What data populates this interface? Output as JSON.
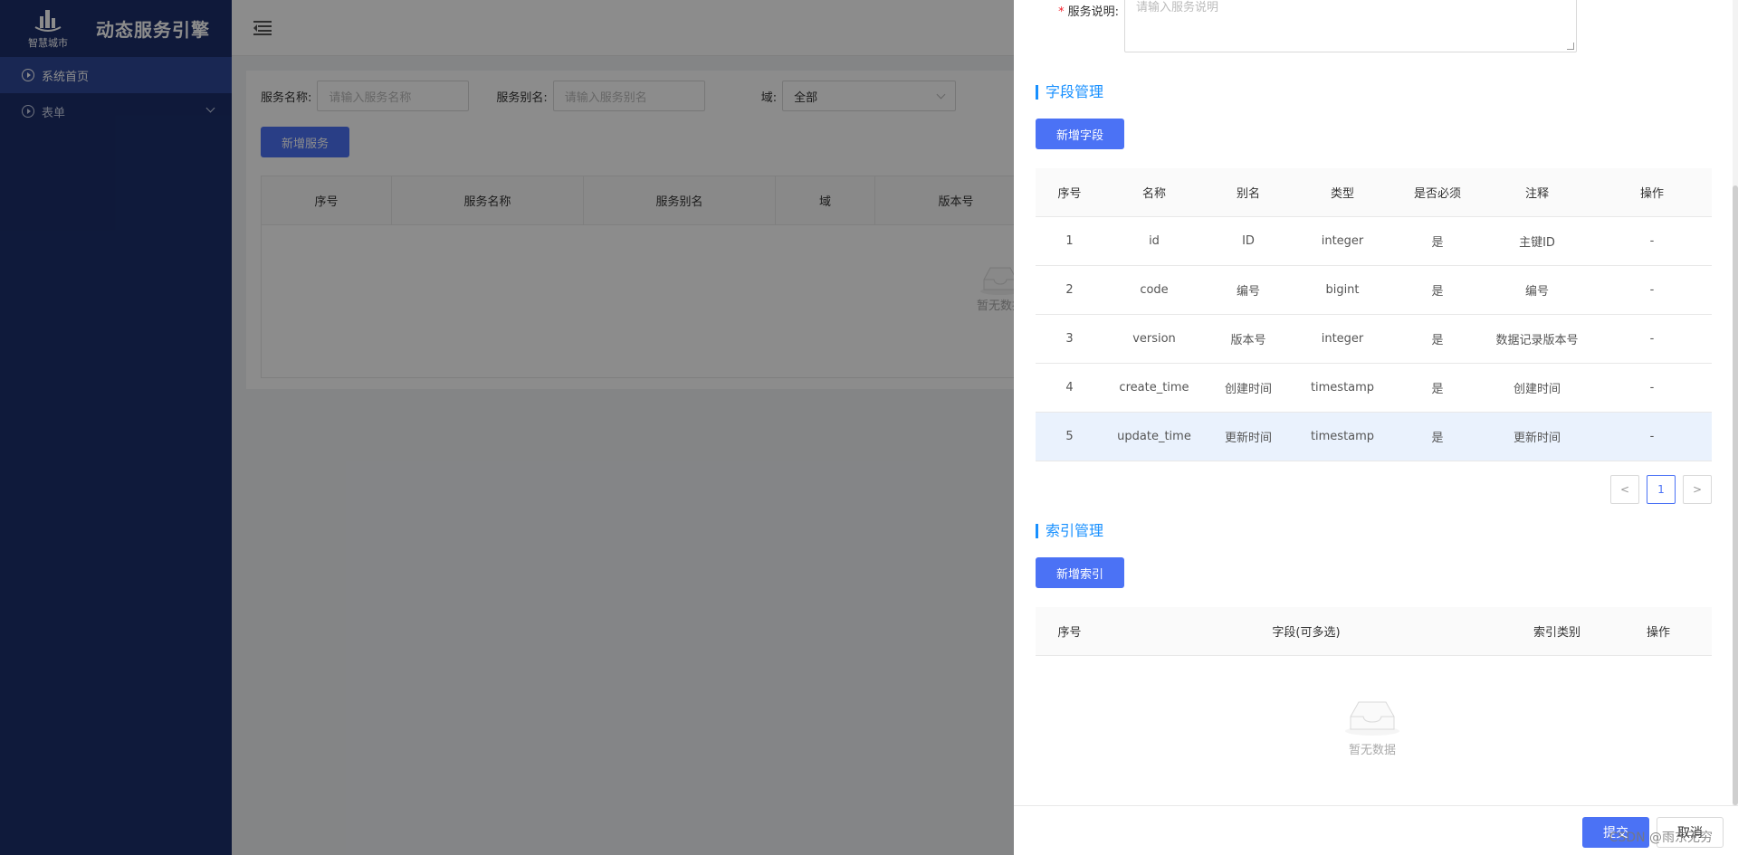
{
  "sidebar": {
    "logo_text": "智慧城市",
    "app_title": "动态服务引擎",
    "items": [
      {
        "label": "系统首页",
        "icon": "play-circle-icon",
        "active": true
      },
      {
        "label": "表单",
        "icon": "play-circle-icon",
        "expandable": true
      }
    ]
  },
  "filters": {
    "service_name_label": "服务名称:",
    "service_name_placeholder": "请输入服务名称",
    "service_alias_label": "服务别名:",
    "service_alias_placeholder": "请输入服务别名",
    "domain_label": "域:",
    "domain_value": "全部"
  },
  "toolbar": {
    "add_service_label": "新增服务"
  },
  "service_table": {
    "columns": [
      "序号",
      "服务名称",
      "服务别名",
      "域",
      "版本号"
    ],
    "empty_text": "暂无数据"
  },
  "drawer": {
    "description_label": "服务说明:",
    "description_placeholder": "请输入服务说明",
    "field_section": {
      "title": "字段管理",
      "add_label": "新增字段",
      "columns": [
        "序号",
        "名称",
        "别名",
        "类型",
        "是否必须",
        "注释",
        "操作"
      ],
      "rows": [
        [
          "1",
          "id",
          "ID",
          "integer",
          "是",
          "主键ID",
          "-"
        ],
        [
          "2",
          "code",
          "编号",
          "bigint",
          "是",
          "编号",
          "-"
        ],
        [
          "3",
          "version",
          "版本号",
          "integer",
          "是",
          "数据记录版本号",
          "-"
        ],
        [
          "4",
          "create_time",
          "创建时间",
          "timestamp",
          "是",
          "创建时间",
          "-"
        ],
        [
          "5",
          "update_time",
          "更新时间",
          "timestamp",
          "是",
          "更新时间",
          "-"
        ]
      ],
      "pager": {
        "prev": "<",
        "current": "1",
        "next": ">"
      }
    },
    "index_section": {
      "title": "索引管理",
      "add_label": "新增索引",
      "columns": [
        "序号",
        "字段(可多选)",
        "索引类别",
        "操作"
      ],
      "empty_text": "暂无数据"
    },
    "footer": {
      "submit_label": "提交",
      "cancel_label": "取消"
    }
  },
  "watermark": "CSDN @雨东无穷",
  "colors": {
    "sidebar_bg": "#1c2f6b",
    "primary": "#4b72f5",
    "section_accent": "#1890ff",
    "row_highlight": "#eaf2fd"
  }
}
